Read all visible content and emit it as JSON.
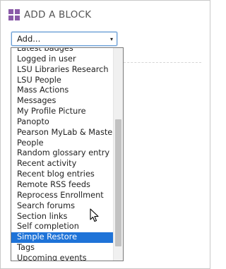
{
  "block": {
    "title": "ADD A BLOCK",
    "icon": "blocks-grid-icon",
    "accent_color": "#8a5aa8"
  },
  "select": {
    "value": "Add...",
    "arrow": "▾"
  },
  "dropdown": {
    "selected_index": 18,
    "selected_color": "#1e73d8",
    "items": [
      "Latest badges",
      "Logged in user",
      "LSU Libraries Research",
      "LSU People",
      "Mass Actions",
      "Messages",
      "My Profile Picture",
      "Panopto",
      "Pearson MyLab & Mastering",
      "People",
      "Random glossary entry",
      "Recent activity",
      "Recent blog entries",
      "Remote RSS feeds",
      "Reprocess Enrollment",
      "Search forums",
      "Section links",
      "Self completion",
      "Simple Restore",
      "Tags",
      "Upcoming events"
    ]
  }
}
